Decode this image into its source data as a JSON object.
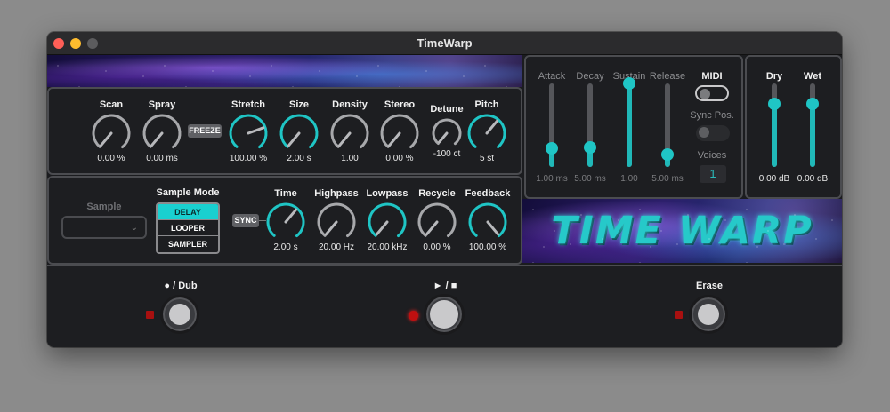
{
  "window": {
    "title": "TimeWarp"
  },
  "logo": {
    "text": "TIME WARP"
  },
  "granular": {
    "knobs": [
      {
        "id": "scan",
        "label": "Scan",
        "value": "0.00 %",
        "active": false
      },
      {
        "id": "spray",
        "label": "Spray",
        "value": "0.00 ms",
        "active": false
      },
      {
        "id": "stretch",
        "label": "Stretch",
        "value": "100.00 %",
        "active": true
      },
      {
        "id": "size",
        "label": "Size",
        "value": "2.00 s",
        "active": true
      },
      {
        "id": "density",
        "label": "Density",
        "value": "1.00",
        "active": false
      },
      {
        "id": "stereo",
        "label": "Stereo",
        "value": "0.00 %",
        "active": false
      },
      {
        "id": "detune",
        "label": "Detune",
        "value": "-100 ct",
        "active": false
      },
      {
        "id": "pitch",
        "label": "Pitch",
        "value": "5 st",
        "active": true
      }
    ],
    "freeze_label": "FREEZE"
  },
  "sample": {
    "label": "Sample",
    "value": ""
  },
  "sample_mode": {
    "label": "Sample Mode",
    "options": [
      "DELAY",
      "LOOPER",
      "SAMPLER"
    ],
    "selected": "DELAY"
  },
  "delay": {
    "sync_label": "SYNC",
    "knobs": [
      {
        "id": "time",
        "label": "Time",
        "value": "2.00 s",
        "active": true
      },
      {
        "id": "highpass",
        "label": "Highpass",
        "value": "20.00 Hz",
        "active": false
      },
      {
        "id": "lowpass",
        "label": "Lowpass",
        "value": "20.00 kHz",
        "active": true
      },
      {
        "id": "recycle",
        "label": "Recycle",
        "value": "0.00 %",
        "active": false
      },
      {
        "id": "feedback",
        "label": "Feedback",
        "value": "100.00 %",
        "active": true
      }
    ]
  },
  "envelope": {
    "sliders": [
      {
        "id": "attack",
        "label": "Attack",
        "value": "1.00 ms",
        "level": 0.22
      },
      {
        "id": "decay",
        "label": "Decay",
        "value": "5.00 ms",
        "level": 0.23
      },
      {
        "id": "sustain",
        "label": "Sustain",
        "value": "1.00",
        "level": 1.0
      },
      {
        "id": "release",
        "label": "Release",
        "value": "5.00 ms",
        "level": 0.15
      }
    ],
    "midi_label": "MIDI",
    "sync_pos_label": "Sync Pos.",
    "voices_label": "Voices",
    "voices_value": "1"
  },
  "mix": {
    "sliders": [
      {
        "id": "dry",
        "label": "Dry",
        "value": "0.00 dB",
        "level": 0.76
      },
      {
        "id": "wet",
        "label": "Wet",
        "value": "0.00 dB",
        "level": 0.76
      }
    ]
  },
  "transport": {
    "record_label": "● / Dub",
    "play_label": "► / ■",
    "erase_label": "Erase"
  },
  "colors": {
    "accent": "#1fc5c5",
    "panel": "#1d1e21",
    "border": "#4b4c50",
    "led": "#c01010"
  }
}
